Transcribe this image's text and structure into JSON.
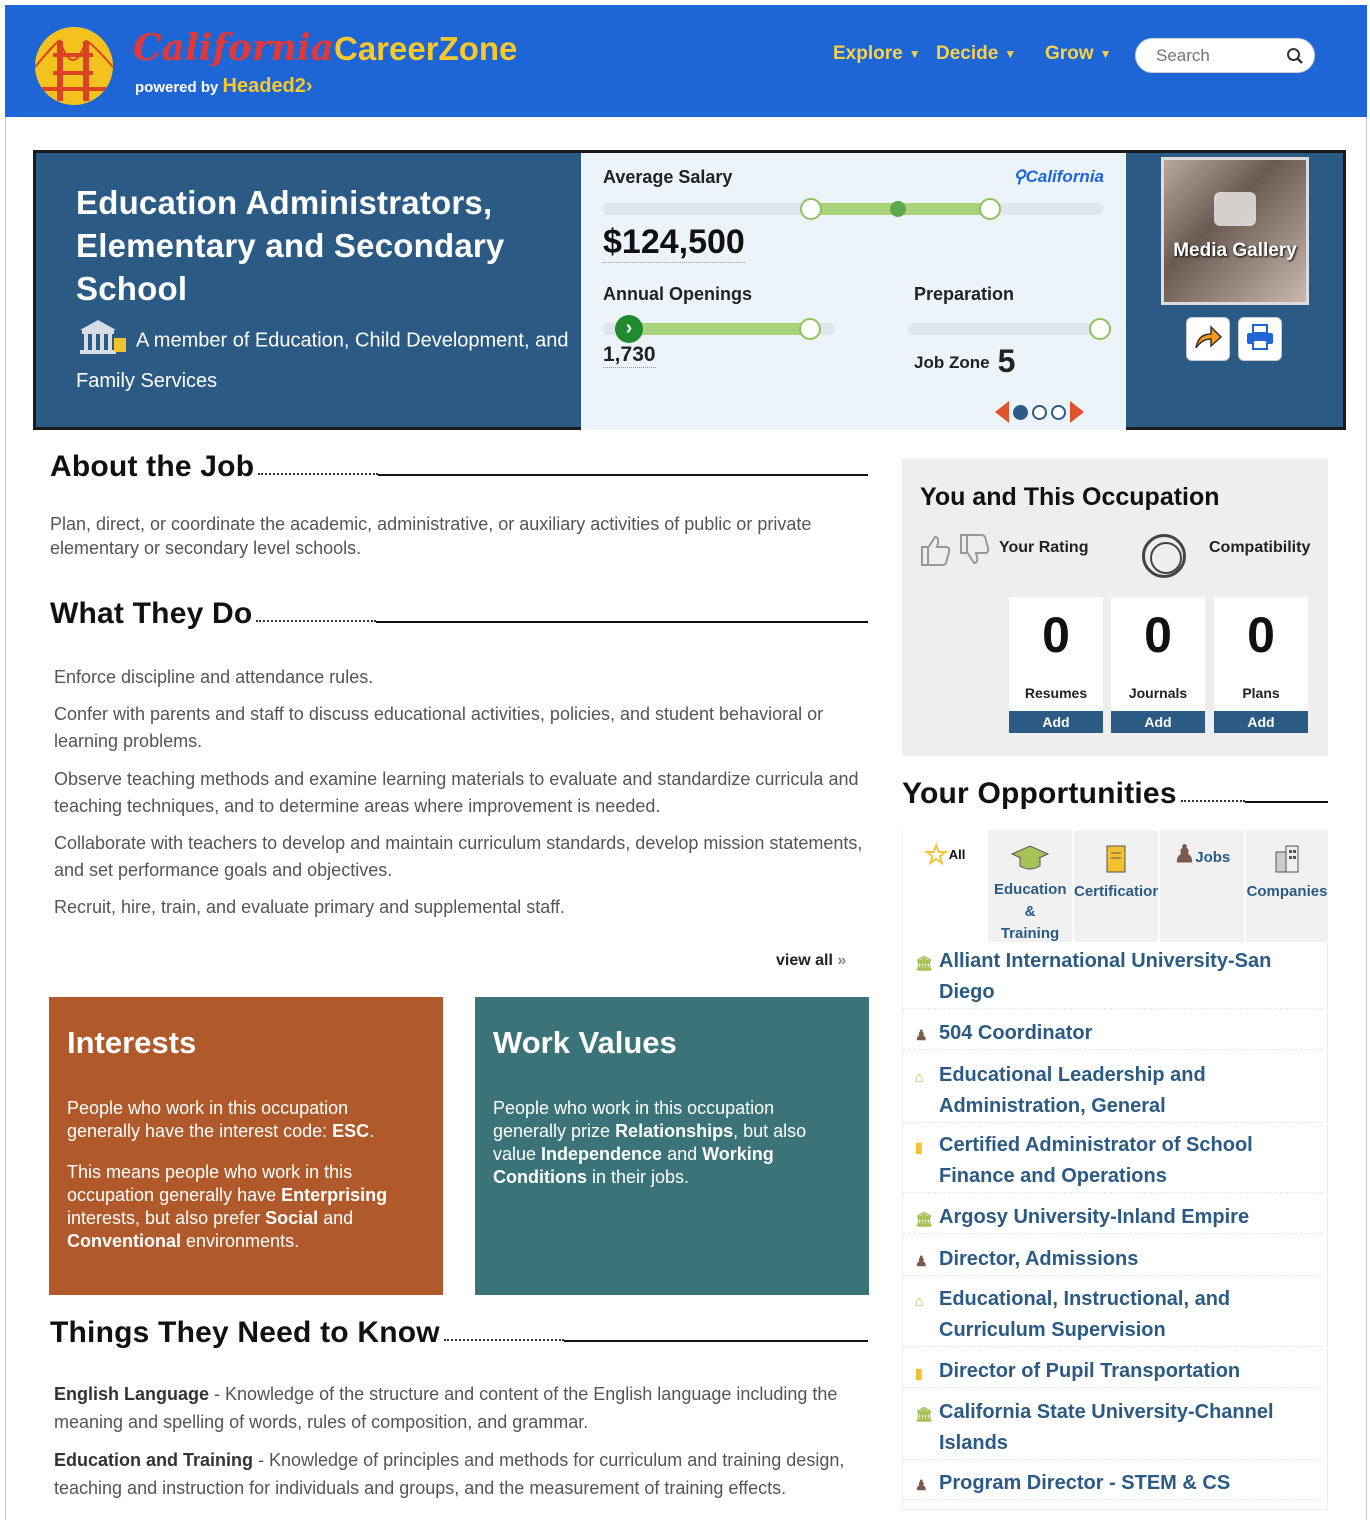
{
  "header": {
    "logo_script": "California",
    "logo_zone": "CareerZone",
    "powered_by": "powered by",
    "powered_brand": "Headed2",
    "nav": [
      "Explore",
      "Decide",
      "Grow"
    ],
    "search_placeholder": "Search"
  },
  "occupation": {
    "title_lines": [
      "Education Administrators,",
      "Elementary and Secondary",
      "School"
    ],
    "member_text": "A member of Education, Child Development, and Family Services"
  },
  "stats": {
    "salary_label": "Average Salary",
    "location": "California",
    "salary_value": "$124,500",
    "openings_label": "Annual Openings",
    "openings_value": "1,730",
    "preparation_label": "Preparation",
    "job_zone_label": "Job Zone",
    "job_zone_value": "5",
    "carousel_pages": 3,
    "carousel_active": 1
  },
  "media": {
    "label": "Media Gallery"
  },
  "about": {
    "heading": "About the Job",
    "text": "Plan, direct, or coordinate the academic, administrative, or auxiliary activities of public or private elementary or secondary level schools."
  },
  "what_they_do": {
    "heading": "What They Do",
    "tasks": [
      "Enforce discipline and attendance rules.",
      "Confer with parents and staff to discuss educational activities, policies, and student behavioral or learning problems.",
      "Observe teaching methods and examine learning materials to evaluate and standardize curricula and teaching techniques, and to determine areas where improvement is needed.",
      "Collaborate with teachers to develop and maintain curriculum standards, develop mission statements, and set performance goals and objectives.",
      "Recruit, hire, train, and evaluate primary and supplemental staff."
    ],
    "view_all": "view all"
  },
  "interests": {
    "heading": "Interests",
    "p1_a": "People who work in this occupation generally have the interest code: ",
    "p1_b": "ESC",
    "p1_c": ".",
    "p2_a": "This means people who work in this occupation generally have ",
    "p2_b": "Enterprising",
    "p2_c": " interests, but also prefer ",
    "p2_d": "Social",
    "p2_e": " and ",
    "p2_f": "Conventional",
    "p2_g": " environments.",
    "color": "#b0592a"
  },
  "work_values": {
    "heading": "Work Values",
    "p_a": "People who work in this occupation generally prize ",
    "p_b": "Relationships",
    "p_c": ", but also value ",
    "p_d": "Independence",
    "p_e": " and ",
    "p_f": "Working Conditions",
    "p_g": " in their jobs.",
    "color": "#3a7479"
  },
  "know": {
    "heading": "Things They Need to Know",
    "items": [
      {
        "name": "English Language",
        "desc": " - Knowledge of the structure and content of the English language including the meaning and spelling of words, rules of composition, and grammar."
      },
      {
        "name": "Education and Training",
        "desc": " - Knowledge of principles and methods for curriculum and training design, teaching and instruction for individuals and groups, and the measurement of training effects."
      }
    ]
  },
  "you": {
    "title": "You and This Occupation",
    "rating_label": "Your Rating",
    "compat_label": "Compatibility",
    "counters": [
      {
        "value": "0",
        "label": "Resumes",
        "action": "Add"
      },
      {
        "value": "0",
        "label": "Journals",
        "action": "Add"
      },
      {
        "value": "0",
        "label": "Plans",
        "action": "Add"
      }
    ]
  },
  "opportunities": {
    "heading": "Your Opportunities",
    "tabs": [
      {
        "label": "All",
        "icon": "star-icon"
      },
      {
        "label": "Education & Training",
        "icon": "graduation-cap-icon"
      },
      {
        "label": "Certification",
        "icon": "certificate-icon"
      },
      {
        "label": "Jobs",
        "icon": "worker-icon"
      },
      {
        "label": "Companies",
        "icon": "building-icon"
      }
    ],
    "items": [
      {
        "label": "Alliant International University-San Diego",
        "icon": "school-icon"
      },
      {
        "label": "504 Coordinator",
        "icon": "job-icon"
      },
      {
        "label": "Educational Leadership and Administration, General",
        "icon": "program-icon"
      },
      {
        "label": "Certified Administrator of School Finance and Operations",
        "icon": "certificate-icon"
      },
      {
        "label": "Argosy University-Inland Empire",
        "icon": "school-icon"
      },
      {
        "label": "Director, Admissions",
        "icon": "job-icon"
      },
      {
        "label": "Educational, Instructional, and Curriculum Supervision",
        "icon": "program-icon"
      },
      {
        "label": "Director of Pupil Transportation",
        "icon": "certificate-icon"
      },
      {
        "label": "California State University-Channel Islands",
        "icon": "school-icon"
      },
      {
        "label": "Program Director - STEM & CS",
        "icon": "job-icon"
      }
    ]
  }
}
